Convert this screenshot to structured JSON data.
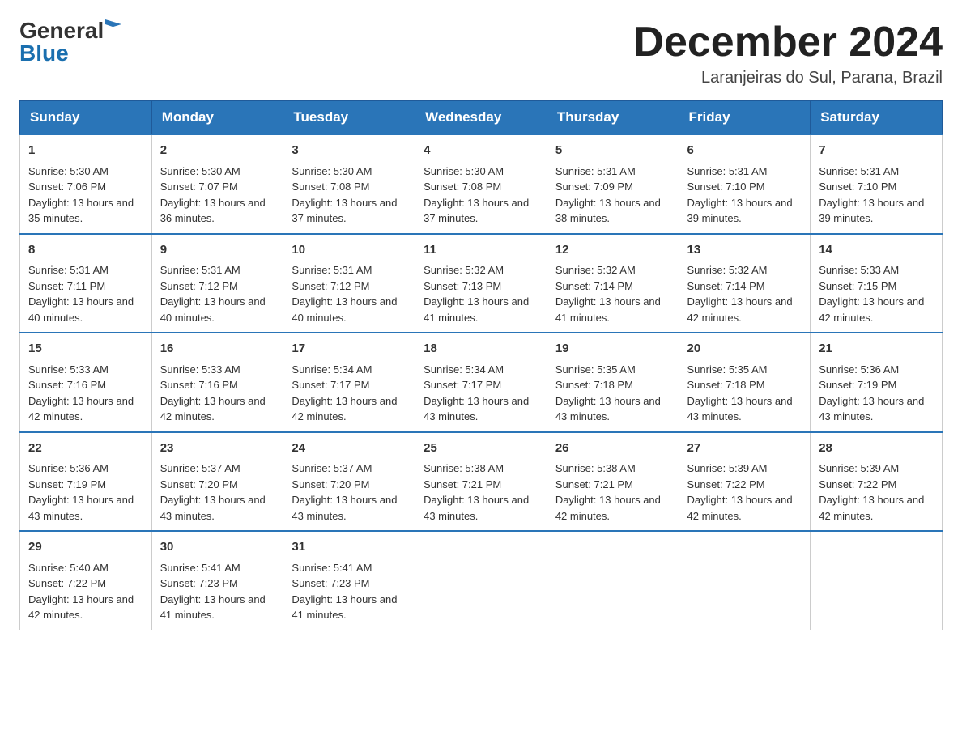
{
  "logo": {
    "general": "General",
    "blue": "Blue"
  },
  "header": {
    "month_year": "December 2024",
    "location": "Laranjeiras do Sul, Parana, Brazil"
  },
  "days_of_week": [
    "Sunday",
    "Monday",
    "Tuesday",
    "Wednesday",
    "Thursday",
    "Friday",
    "Saturday"
  ],
  "weeks": [
    [
      {
        "day": "1",
        "sunrise": "Sunrise: 5:30 AM",
        "sunset": "Sunset: 7:06 PM",
        "daylight": "Daylight: 13 hours and 35 minutes."
      },
      {
        "day": "2",
        "sunrise": "Sunrise: 5:30 AM",
        "sunset": "Sunset: 7:07 PM",
        "daylight": "Daylight: 13 hours and 36 minutes."
      },
      {
        "day": "3",
        "sunrise": "Sunrise: 5:30 AM",
        "sunset": "Sunset: 7:08 PM",
        "daylight": "Daylight: 13 hours and 37 minutes."
      },
      {
        "day": "4",
        "sunrise": "Sunrise: 5:30 AM",
        "sunset": "Sunset: 7:08 PM",
        "daylight": "Daylight: 13 hours and 37 minutes."
      },
      {
        "day": "5",
        "sunrise": "Sunrise: 5:31 AM",
        "sunset": "Sunset: 7:09 PM",
        "daylight": "Daylight: 13 hours and 38 minutes."
      },
      {
        "day": "6",
        "sunrise": "Sunrise: 5:31 AM",
        "sunset": "Sunset: 7:10 PM",
        "daylight": "Daylight: 13 hours and 39 minutes."
      },
      {
        "day": "7",
        "sunrise": "Sunrise: 5:31 AM",
        "sunset": "Sunset: 7:10 PM",
        "daylight": "Daylight: 13 hours and 39 minutes."
      }
    ],
    [
      {
        "day": "8",
        "sunrise": "Sunrise: 5:31 AM",
        "sunset": "Sunset: 7:11 PM",
        "daylight": "Daylight: 13 hours and 40 minutes."
      },
      {
        "day": "9",
        "sunrise": "Sunrise: 5:31 AM",
        "sunset": "Sunset: 7:12 PM",
        "daylight": "Daylight: 13 hours and 40 minutes."
      },
      {
        "day": "10",
        "sunrise": "Sunrise: 5:31 AM",
        "sunset": "Sunset: 7:12 PM",
        "daylight": "Daylight: 13 hours and 40 minutes."
      },
      {
        "day": "11",
        "sunrise": "Sunrise: 5:32 AM",
        "sunset": "Sunset: 7:13 PM",
        "daylight": "Daylight: 13 hours and 41 minutes."
      },
      {
        "day": "12",
        "sunrise": "Sunrise: 5:32 AM",
        "sunset": "Sunset: 7:14 PM",
        "daylight": "Daylight: 13 hours and 41 minutes."
      },
      {
        "day": "13",
        "sunrise": "Sunrise: 5:32 AM",
        "sunset": "Sunset: 7:14 PM",
        "daylight": "Daylight: 13 hours and 42 minutes."
      },
      {
        "day": "14",
        "sunrise": "Sunrise: 5:33 AM",
        "sunset": "Sunset: 7:15 PM",
        "daylight": "Daylight: 13 hours and 42 minutes."
      }
    ],
    [
      {
        "day": "15",
        "sunrise": "Sunrise: 5:33 AM",
        "sunset": "Sunset: 7:16 PM",
        "daylight": "Daylight: 13 hours and 42 minutes."
      },
      {
        "day": "16",
        "sunrise": "Sunrise: 5:33 AM",
        "sunset": "Sunset: 7:16 PM",
        "daylight": "Daylight: 13 hours and 42 minutes."
      },
      {
        "day": "17",
        "sunrise": "Sunrise: 5:34 AM",
        "sunset": "Sunset: 7:17 PM",
        "daylight": "Daylight: 13 hours and 42 minutes."
      },
      {
        "day": "18",
        "sunrise": "Sunrise: 5:34 AM",
        "sunset": "Sunset: 7:17 PM",
        "daylight": "Daylight: 13 hours and 43 minutes."
      },
      {
        "day": "19",
        "sunrise": "Sunrise: 5:35 AM",
        "sunset": "Sunset: 7:18 PM",
        "daylight": "Daylight: 13 hours and 43 minutes."
      },
      {
        "day": "20",
        "sunrise": "Sunrise: 5:35 AM",
        "sunset": "Sunset: 7:18 PM",
        "daylight": "Daylight: 13 hours and 43 minutes."
      },
      {
        "day": "21",
        "sunrise": "Sunrise: 5:36 AM",
        "sunset": "Sunset: 7:19 PM",
        "daylight": "Daylight: 13 hours and 43 minutes."
      }
    ],
    [
      {
        "day": "22",
        "sunrise": "Sunrise: 5:36 AM",
        "sunset": "Sunset: 7:19 PM",
        "daylight": "Daylight: 13 hours and 43 minutes."
      },
      {
        "day": "23",
        "sunrise": "Sunrise: 5:37 AM",
        "sunset": "Sunset: 7:20 PM",
        "daylight": "Daylight: 13 hours and 43 minutes."
      },
      {
        "day": "24",
        "sunrise": "Sunrise: 5:37 AM",
        "sunset": "Sunset: 7:20 PM",
        "daylight": "Daylight: 13 hours and 43 minutes."
      },
      {
        "day": "25",
        "sunrise": "Sunrise: 5:38 AM",
        "sunset": "Sunset: 7:21 PM",
        "daylight": "Daylight: 13 hours and 43 minutes."
      },
      {
        "day": "26",
        "sunrise": "Sunrise: 5:38 AM",
        "sunset": "Sunset: 7:21 PM",
        "daylight": "Daylight: 13 hours and 42 minutes."
      },
      {
        "day": "27",
        "sunrise": "Sunrise: 5:39 AM",
        "sunset": "Sunset: 7:22 PM",
        "daylight": "Daylight: 13 hours and 42 minutes."
      },
      {
        "day": "28",
        "sunrise": "Sunrise: 5:39 AM",
        "sunset": "Sunset: 7:22 PM",
        "daylight": "Daylight: 13 hours and 42 minutes."
      }
    ],
    [
      {
        "day": "29",
        "sunrise": "Sunrise: 5:40 AM",
        "sunset": "Sunset: 7:22 PM",
        "daylight": "Daylight: 13 hours and 42 minutes."
      },
      {
        "day": "30",
        "sunrise": "Sunrise: 5:41 AM",
        "sunset": "Sunset: 7:23 PM",
        "daylight": "Daylight: 13 hours and 41 minutes."
      },
      {
        "day": "31",
        "sunrise": "Sunrise: 5:41 AM",
        "sunset": "Sunset: 7:23 PM",
        "daylight": "Daylight: 13 hours and 41 minutes."
      },
      null,
      null,
      null,
      null
    ]
  ]
}
